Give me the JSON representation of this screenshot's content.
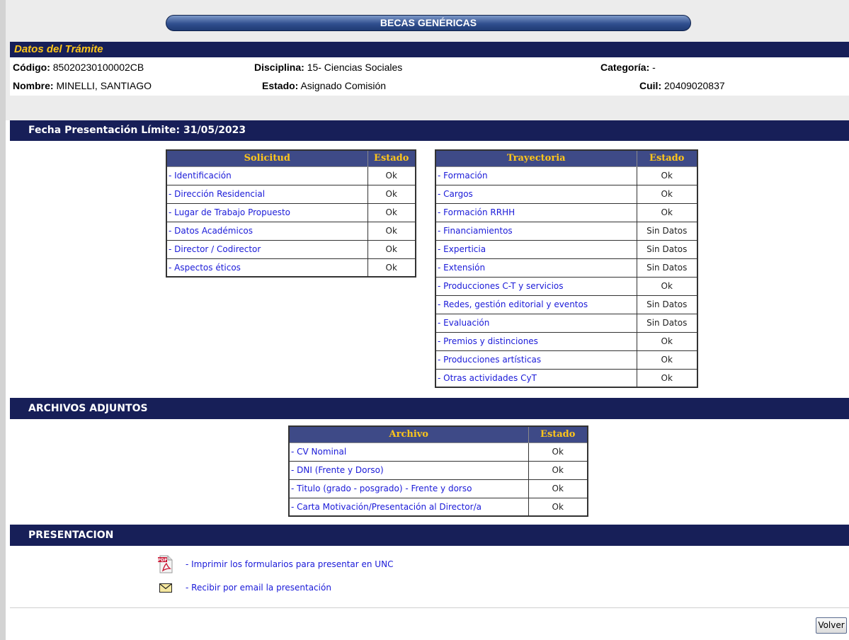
{
  "title": "BECAS GENÉRICAS",
  "datos": {
    "header": "Datos del Trámite",
    "codigo_label": "Código:",
    "codigo": "85020230100002CB",
    "disciplina_label": "Disciplina:",
    "disciplina": "15- Ciencias Sociales",
    "categoria_label": "Categoría:",
    "categoria": "-",
    "nombre_label": "Nombre:",
    "nombre": "MINELLI, SANTIAGO",
    "estado_label": "Estado:",
    "estado": "Asignado Comisión",
    "cuil_label": "Cuil:",
    "cuil": "20409020837"
  },
  "fecha_limite": "Fecha Presentación Límite:  31/05/2023",
  "solicitud": {
    "headers": [
      "Solicitud",
      "Estado"
    ],
    "rows": [
      {
        "label": "- Identificación",
        "estado": "Ok"
      },
      {
        "label": "- Dirección Residencial",
        "estado": "Ok"
      },
      {
        "label": "- Lugar de Trabajo Propuesto",
        "estado": "Ok"
      },
      {
        "label": "- Datos Académicos",
        "estado": "Ok"
      },
      {
        "label": "- Director / Codirector",
        "estado": "Ok"
      },
      {
        "label": "- Aspectos éticos",
        "estado": "Ok"
      }
    ]
  },
  "trayectoria": {
    "headers": [
      "Trayectoria",
      "Estado"
    ],
    "rows": [
      {
        "label": "- Formación",
        "estado": "Ok"
      },
      {
        "label": "- Cargos",
        "estado": "Ok"
      },
      {
        "label": "- Formación RRHH",
        "estado": "Ok"
      },
      {
        "label": "- Financiamientos",
        "estado": "Sin Datos"
      },
      {
        "label": "- Experticia",
        "estado": "Sin Datos"
      },
      {
        "label": "- Extensión",
        "estado": "Sin Datos"
      },
      {
        "label": "- Producciones C-T y servicios",
        "estado": "Ok"
      },
      {
        "label": "- Redes, gestión editorial y eventos",
        "estado": "Sin Datos"
      },
      {
        "label": "- Evaluación",
        "estado": "Sin Datos"
      },
      {
        "label": "- Premios y distinciones",
        "estado": "Ok"
      },
      {
        "label": "- Producciones artísticas",
        "estado": "Ok"
      },
      {
        "label": "- Otras actividades CyT",
        "estado": "Ok"
      }
    ]
  },
  "archivos": {
    "section": "ARCHIVOS ADJUNTOS",
    "headers": [
      "Archivo",
      "Estado"
    ],
    "rows": [
      {
        "label": "- CV Nominal",
        "estado": "Ok"
      },
      {
        "label": "- DNI (Frente y Dorso)",
        "estado": "Ok"
      },
      {
        "label": "- Titulo (grado - posgrado) - Frente y dorso",
        "estado": "Ok"
      },
      {
        "label": "- Carta Motivación/Presentación al Director/a",
        "estado": "Ok"
      }
    ]
  },
  "presentacion": {
    "section": "PRESENTACION",
    "print_label": "- Imprimir los formularios para presentar en UNC",
    "email_label": "- Recibir por email la presentación",
    "print_icon": "pdf-icon",
    "email_icon": "envelope-icon"
  },
  "volver_label": "Volver",
  "colors": {
    "header_bg": "#171f58",
    "table_header_bg": "#3e4a87",
    "accent_gold": "#ffc61a",
    "link": "#1a1ad8"
  }
}
